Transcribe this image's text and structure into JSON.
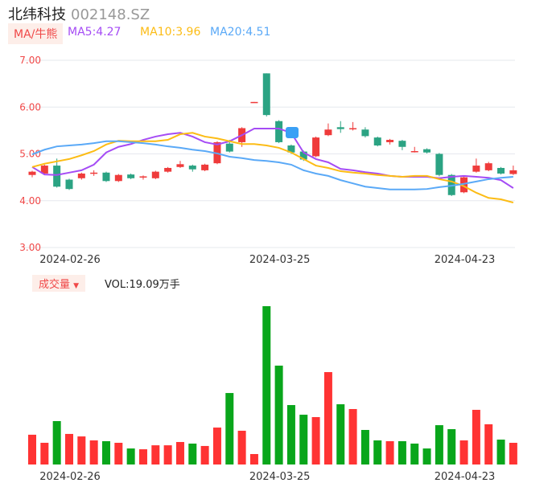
{
  "header": {
    "name": "北纬科技",
    "code": "002148.SZ"
  },
  "legend": {
    "tag": "MA/牛熊",
    "ma5": "MA5:4.27",
    "ma10": "MA10:3.96",
    "ma20": "MA20:4.51"
  },
  "colors": {
    "up": "#ef3b3b",
    "down": "#2ba383",
    "ma5": "#a54cf5",
    "ma10": "#fcbc15",
    "ma20": "#5aa9f7",
    "volUp": "#ff3333",
    "volDown": "#09a61b",
    "grid": "#e6e8ee"
  },
  "volume_panel": {
    "tag": "成交量",
    "label": "VOL:19.09万手"
  },
  "chart_data": [
    {
      "type": "candlestick",
      "title": "北纬科技 002148.SZ",
      "ylim": [
        3,
        7
      ],
      "yticks": [
        "7.00",
        "6.00",
        "5.00",
        "4.00",
        "3.00"
      ],
      "xtick_labels": [
        {
          "index": 3,
          "label": "2024-02-26"
        },
        {
          "index": 20,
          "label": "2024-03-25"
        },
        {
          "index": 35,
          "label": "2024-04-23"
        }
      ],
      "candles": [
        [
          4.55,
          4.62,
          4.64,
          4.5
        ],
        [
          4.58,
          4.75,
          4.77,
          4.56
        ],
        [
          4.75,
          4.3,
          4.9,
          4.28
        ],
        [
          4.45,
          4.25,
          4.47,
          4.23
        ],
        [
          4.48,
          4.58,
          4.6,
          4.45
        ],
        [
          4.58,
          4.6,
          4.65,
          4.53
        ],
        [
          4.6,
          4.42,
          4.62,
          4.4
        ],
        [
          4.42,
          4.55,
          4.57,
          4.4
        ],
        [
          4.56,
          4.48,
          4.58,
          4.46
        ],
        [
          4.5,
          4.52,
          4.54,
          4.45
        ],
        [
          4.48,
          4.62,
          4.64,
          4.46
        ],
        [
          4.62,
          4.7,
          4.72,
          4.6
        ],
        [
          4.72,
          4.78,
          4.85,
          4.7
        ],
        [
          4.75,
          4.67,
          4.77,
          4.62
        ],
        [
          4.65,
          4.77,
          4.79,
          4.63
        ],
        [
          4.8,
          5.25,
          5.27,
          4.78
        ],
        [
          5.22,
          5.05,
          5.3,
          5.03
        ],
        [
          5.25,
          5.55,
          5.57,
          5.15
        ],
        [
          6.1,
          6.11,
          6.11,
          6.1
        ],
        [
          6.72,
          5.83,
          6.72,
          5.8
        ],
        [
          5.7,
          5.25,
          5.72,
          5.23
        ],
        [
          5.18,
          5.03,
          5.2,
          5.0
        ],
        [
          5.05,
          4.88,
          5.07,
          4.85
        ],
        [
          4.95,
          5.35,
          5.37,
          4.93
        ],
        [
          5.4,
          5.52,
          5.65,
          5.38
        ],
        [
          5.57,
          5.53,
          5.7,
          5.45
        ],
        [
          5.53,
          5.55,
          5.68,
          5.5
        ],
        [
          5.52,
          5.38,
          5.57,
          5.35
        ],
        [
          5.35,
          5.18,
          5.37,
          5.16
        ],
        [
          5.25,
          5.3,
          5.32,
          5.2
        ],
        [
          5.28,
          5.15,
          5.3,
          5.08
        ],
        [
          5.05,
          5.06,
          5.15,
          5.03
        ],
        [
          5.1,
          5.03,
          5.12,
          5.01
        ],
        [
          5.0,
          4.55,
          5.02,
          4.52
        ],
        [
          4.55,
          4.12,
          4.57,
          4.1
        ],
        [
          4.18,
          4.5,
          4.52,
          4.16
        ],
        [
          4.62,
          4.75,
          4.9,
          4.6
        ],
        [
          4.65,
          4.8,
          4.83,
          4.63
        ],
        [
          4.7,
          4.58,
          4.72,
          4.56
        ],
        [
          4.57,
          4.65,
          4.75,
          4.55
        ]
      ],
      "series": [
        {
          "name": "MA5",
          "values": [
            4.72,
            4.56,
            4.55,
            4.6,
            4.65,
            4.77,
            5.03,
            5.15,
            5.21,
            5.3,
            5.37,
            5.42,
            5.45,
            5.37,
            5.25,
            5.2,
            5.27,
            5.4,
            5.54,
            5.54,
            5.54,
            5.45,
            5.03,
            4.89,
            4.82,
            4.68,
            4.65,
            4.61,
            4.58,
            4.53,
            4.51,
            4.51,
            4.51,
            4.48,
            4.51,
            4.53,
            4.51,
            4.49,
            4.44,
            4.27
          ]
        },
        {
          "name": "MA10",
          "values": [
            4.72,
            4.79,
            4.84,
            4.89,
            4.97,
            5.06,
            5.2,
            5.28,
            5.27,
            5.27,
            5.27,
            5.3,
            5.42,
            5.45,
            5.37,
            5.33,
            5.27,
            5.21,
            5.21,
            5.18,
            5.13,
            5.03,
            4.89,
            4.75,
            4.7,
            4.63,
            4.6,
            4.58,
            4.55,
            4.53,
            4.51,
            4.53,
            4.53,
            4.46,
            4.41,
            4.31,
            4.17,
            4.06,
            4.03,
            3.96
          ]
        },
        {
          "name": "MA20",
          "values": [
            4.99,
            5.09,
            5.16,
            5.18,
            5.2,
            5.23,
            5.27,
            5.27,
            5.25,
            5.23,
            5.2,
            5.16,
            5.13,
            5.09,
            5.06,
            5.01,
            4.94,
            4.91,
            4.87,
            4.85,
            4.82,
            4.77,
            4.65,
            4.58,
            4.53,
            4.44,
            4.37,
            4.3,
            4.27,
            4.24,
            4.24,
            4.24,
            4.25,
            4.29,
            4.32,
            4.36,
            4.41,
            4.46,
            4.49,
            4.51
          ]
        }
      ]
    },
    {
      "type": "bar",
      "title": "成交量",
      "unit": "万手",
      "values": [
        26.2,
        19.1,
        38.2,
        26.9,
        24.7,
        21.2,
        20.5,
        19.1,
        14.1,
        13.4,
        16.9,
        16.9,
        19.8,
        18.4,
        16.3,
        32.5,
        62.9,
        29.7,
        9.2,
        139.3,
        87.0,
        52.3,
        43.8,
        41.7,
        81.3,
        53.0,
        48.8,
        30.4,
        21.2,
        20.5,
        20.5,
        18.4,
        14.1,
        34.6,
        31.1,
        21.2,
        48.1,
        35.4,
        21.9,
        19.09
      ],
      "direction": [
        "up",
        "up",
        "down",
        "up",
        "up",
        "up",
        "down",
        "up",
        "down",
        "up",
        "up",
        "up",
        "up",
        "down",
        "up",
        "up",
        "down",
        "up",
        "up",
        "down",
        "down",
        "down",
        "down",
        "up",
        "up",
        "down",
        "up",
        "down",
        "down",
        "up",
        "down",
        "down",
        "down",
        "down",
        "down",
        "up",
        "up",
        "up",
        "down",
        "up"
      ]
    }
  ]
}
